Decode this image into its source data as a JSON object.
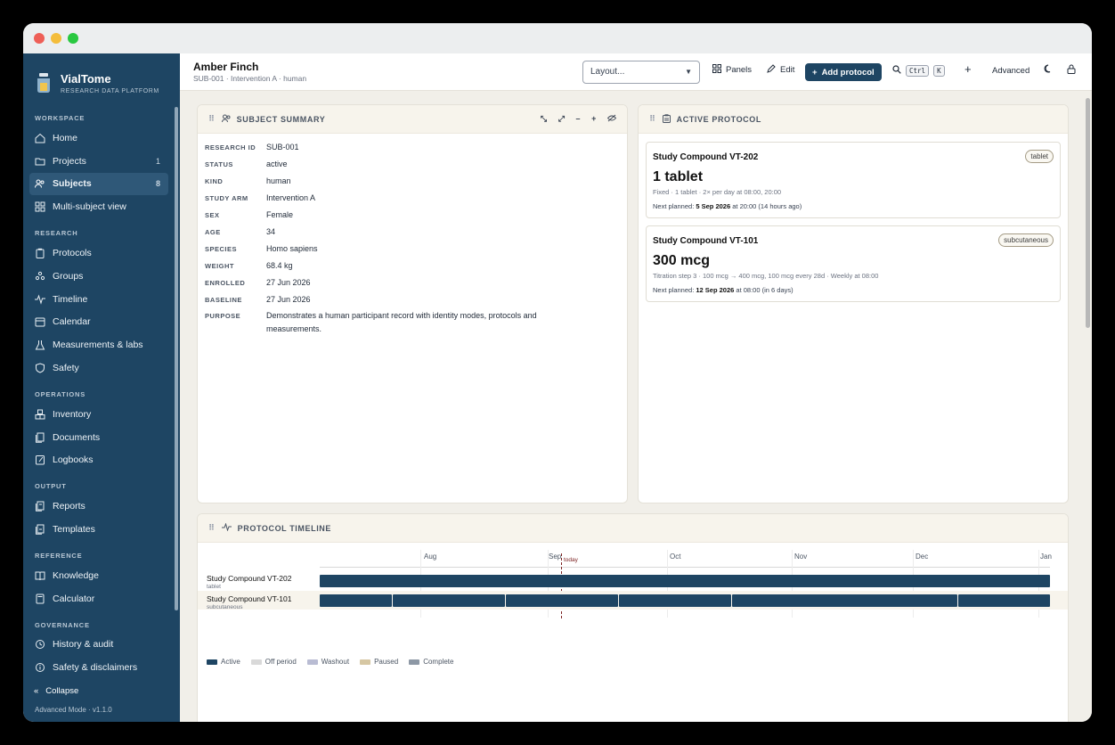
{
  "window": {
    "traffic_lights": [
      "#ee5f57",
      "#f4bd3b",
      "#29c840"
    ]
  },
  "brand": {
    "name": "VialTome",
    "subtitle": "RESEARCH DATA PLATFORM"
  },
  "sidebar": {
    "sections": [
      {
        "label": "WORKSPACE",
        "items": [
          {
            "label": "Home",
            "icon": "home-icon"
          },
          {
            "label": "Projects",
            "icon": "folder-icon",
            "count": "1"
          },
          {
            "label": "Subjects",
            "icon": "users-icon",
            "count": "8",
            "active": true
          },
          {
            "label": "Multi-subject view",
            "icon": "grid-icon"
          }
        ]
      },
      {
        "label": "RESEARCH",
        "items": [
          {
            "label": "Protocols",
            "icon": "clipboard-icon"
          },
          {
            "label": "Groups",
            "icon": "groups-icon"
          },
          {
            "label": "Timeline",
            "icon": "activity-icon"
          },
          {
            "label": "Calendar",
            "icon": "calendar-icon"
          },
          {
            "label": "Measurements & labs",
            "icon": "flask-icon"
          },
          {
            "label": "Safety",
            "icon": "shield-icon"
          }
        ]
      },
      {
        "label": "OPERATIONS",
        "items": [
          {
            "label": "Inventory",
            "icon": "boxes-icon"
          },
          {
            "label": "Documents",
            "icon": "documents-icon"
          },
          {
            "label": "Logbooks",
            "icon": "logbook-icon"
          }
        ]
      },
      {
        "label": "OUTPUT",
        "items": [
          {
            "label": "Reports",
            "icon": "report-icon"
          },
          {
            "label": "Templates",
            "icon": "template-icon"
          }
        ]
      },
      {
        "label": "REFERENCE",
        "items": [
          {
            "label": "Knowledge",
            "icon": "book-icon"
          },
          {
            "label": "Calculator",
            "icon": "calculator-icon"
          }
        ]
      },
      {
        "label": "GOVERNANCE",
        "items": [
          {
            "label": "History & audit",
            "icon": "history-icon"
          },
          {
            "label": "Safety & disclaimers",
            "icon": "info-icon"
          }
        ]
      }
    ],
    "collapse_label": "Collapse",
    "version": "Advanced Mode · v1.1.0"
  },
  "header": {
    "name": "Amber Finch",
    "subtitle": "SUB-001 · Intervention A · human",
    "layout_value": "Layout...",
    "panels_label": "Panels",
    "edit_label": "Edit",
    "add_protocol_label": "Add protocol",
    "kbd_ctrl": "Ctrl",
    "kbd_k": "K",
    "plus_label": "+",
    "advanced_label": "Advanced"
  },
  "summary": {
    "title": "SUBJECT SUMMARY",
    "tools": [
      "⤡",
      "⤢",
      "–",
      "+"
    ],
    "fields": [
      {
        "key": "RESEARCH ID",
        "value": "SUB-001"
      },
      {
        "key": "STATUS",
        "value": "active"
      },
      {
        "key": "KIND",
        "value": "human"
      },
      {
        "key": "STUDY ARM",
        "value": "Intervention A"
      },
      {
        "key": "SEX",
        "value": "Female"
      },
      {
        "key": "AGE",
        "value": "34"
      },
      {
        "key": "SPECIES",
        "value": "Homo sapiens"
      },
      {
        "key": "WEIGHT",
        "value": "68.4 kg"
      },
      {
        "key": "ENROLLED",
        "value": "27 Jun 2026"
      },
      {
        "key": "BASELINE",
        "value": "27 Jun 2026"
      },
      {
        "key": "PURPOSE",
        "value": "Demonstrates a human participant record with identity modes, protocols and measurements."
      }
    ]
  },
  "active_protocol": {
    "title": "ACTIVE PROTOCOL",
    "items": [
      {
        "name": "Study Compound VT-202",
        "badge": "tablet",
        "dose": "1 tablet",
        "schedule": "Fixed · 1 tablet · 2× per day at 08:00, 20:00",
        "next_prefix": "Next planned: ",
        "next_date": "5 Sep 2026",
        "next_suffix": " at 20:00 (14 hours ago)"
      },
      {
        "name": "Study Compound VT-101",
        "badge": "subcutaneous",
        "dose": "300 mcg",
        "schedule": "Titration step 3 · 100 mcg → 400 mcg, 100 mcg every 28d · Weekly at 08:00",
        "next_prefix": "Next planned: ",
        "next_date": "12 Sep 2026",
        "next_suffix": " at 08:00 (in 6 days)"
      }
    ]
  },
  "timeline": {
    "title": "PROTOCOL TIMELINE",
    "months": [
      "Aug",
      "Sep",
      "Oct",
      "Nov",
      "Dec",
      "Jan"
    ],
    "today_label": "today",
    "rows": [
      {
        "name": "Study Compound VT-202",
        "route": "tablet"
      },
      {
        "name": "Study Compound VT-101",
        "route": "subcutaneous"
      }
    ],
    "legend": [
      {
        "label": "Active",
        "color": "#1e4563"
      },
      {
        "label": "Off period",
        "color": "#d9d9d9"
      },
      {
        "label": "Washout",
        "color": "#b9bcd3"
      },
      {
        "label": "Paused",
        "color": "#d6c7a3"
      },
      {
        "label": "Complete",
        "color": "#8d98a5"
      }
    ]
  }
}
